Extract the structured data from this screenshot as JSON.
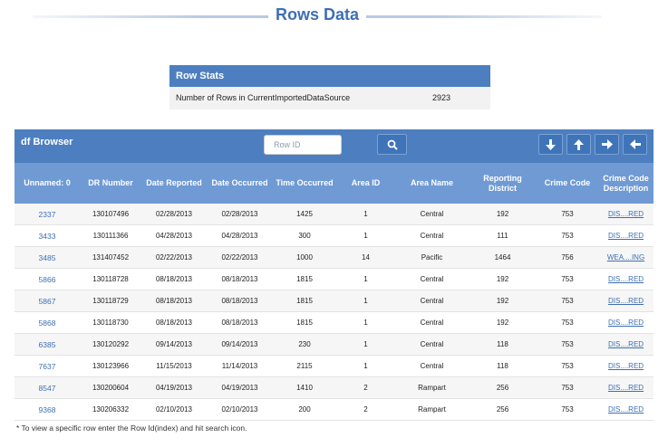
{
  "page_title": "Rows Data",
  "row_stats": {
    "header": "Row Stats",
    "label": "Number of Rows in CurrentImportedDataSource",
    "value": "2923"
  },
  "browser": {
    "title": "df Browser",
    "search_placeholder": "Row ID",
    "columns": [
      "Unnamed: 0",
      "DR Number",
      "Date Reported",
      "Date Occurred",
      "Time Occurred",
      "Area ID",
      "Area Name",
      "Reporting District",
      "Crime Code",
      "Crime Code Description"
    ],
    "rows": [
      [
        "2337",
        "130107496",
        "02/28/2013",
        "02/28/2013",
        "1425",
        "1",
        "Central",
        "192",
        "753",
        "DIS....RED"
      ],
      [
        "3433",
        "130111366",
        "04/28/2013",
        "04/28/2013",
        "300",
        "1",
        "Central",
        "111",
        "753",
        "DIS....RED"
      ],
      [
        "3485",
        "131407452",
        "02/22/2013",
        "02/22/2013",
        "1000",
        "14",
        "Pacific",
        "1464",
        "756",
        "WEA....ING"
      ],
      [
        "5866",
        "130118728",
        "08/18/2013",
        "08/18/2013",
        "1815",
        "1",
        "Central",
        "192",
        "753",
        "DIS....RED"
      ],
      [
        "5867",
        "130118729",
        "08/18/2013",
        "08/18/2013",
        "1815",
        "1",
        "Central",
        "192",
        "753",
        "DIS....RED"
      ],
      [
        "5868",
        "130118730",
        "08/18/2013",
        "08/18/2013",
        "1815",
        "1",
        "Central",
        "192",
        "753",
        "DIS....RED"
      ],
      [
        "6385",
        "130120292",
        "09/14/2013",
        "09/14/2013",
        "230",
        "1",
        "Central",
        "118",
        "753",
        "DIS....RED"
      ],
      [
        "7637",
        "130123966",
        "11/15/2013",
        "11/14/2013",
        "2115",
        "1",
        "Central",
        "118",
        "753",
        "DIS....RED"
      ],
      [
        "8547",
        "130200604",
        "04/19/2013",
        "04/19/2013",
        "1410",
        "2",
        "Rampart",
        "256",
        "753",
        "DIS....RED"
      ],
      [
        "9368",
        "130206332",
        "02/10/2013",
        "02/10/2013",
        "200",
        "2",
        "Rampart",
        "256",
        "753",
        "DIS....RED"
      ]
    ]
  },
  "icons": {
    "search": "search-icon",
    "nav": [
      "arrow-down-icon",
      "arrow-up-icon",
      "arrow-right-icon",
      "arrow-left-icon"
    ]
  },
  "colors": {
    "header_blue": "#4d7fc0",
    "column_header_blue": "#6f9ad4",
    "title_blue": "#3e6fb4",
    "link_blue": "#3d6fb0"
  },
  "footnote": "* To view a specific row enter the Row Id(index) and hit search icon."
}
